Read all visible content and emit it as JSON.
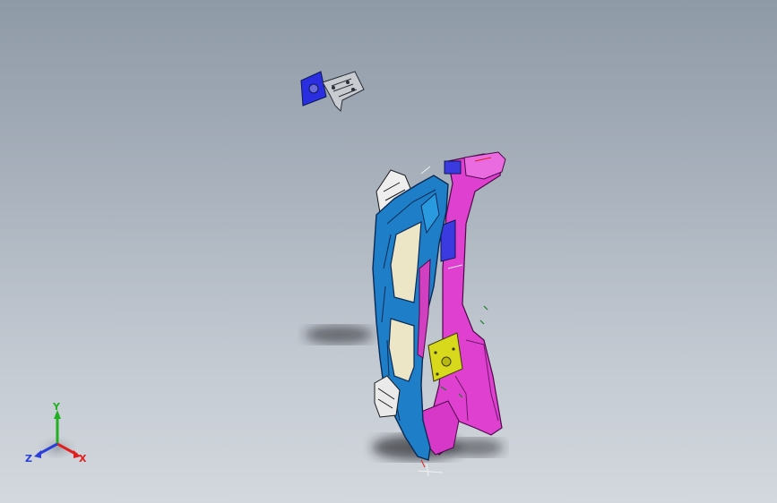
{
  "viewport": {
    "background_top": "#8f9aa7",
    "background_bottom": "#d3d8de"
  },
  "triad": {
    "x_label": "X",
    "y_label": "Y",
    "z_label": "Z",
    "x_color": "#e02020",
    "y_color": "#22b022",
    "z_color": "#2a3fd8"
  },
  "model": {
    "part_colors": {
      "frame_blue": "#1e7fc8",
      "outline": "#0a2a55",
      "panel_cream": "#ece6c6",
      "bracket_magenta": "#e040d0",
      "plate_yellow": "#d8d81c",
      "plate_blue": "#3a3ae0"
    }
  }
}
